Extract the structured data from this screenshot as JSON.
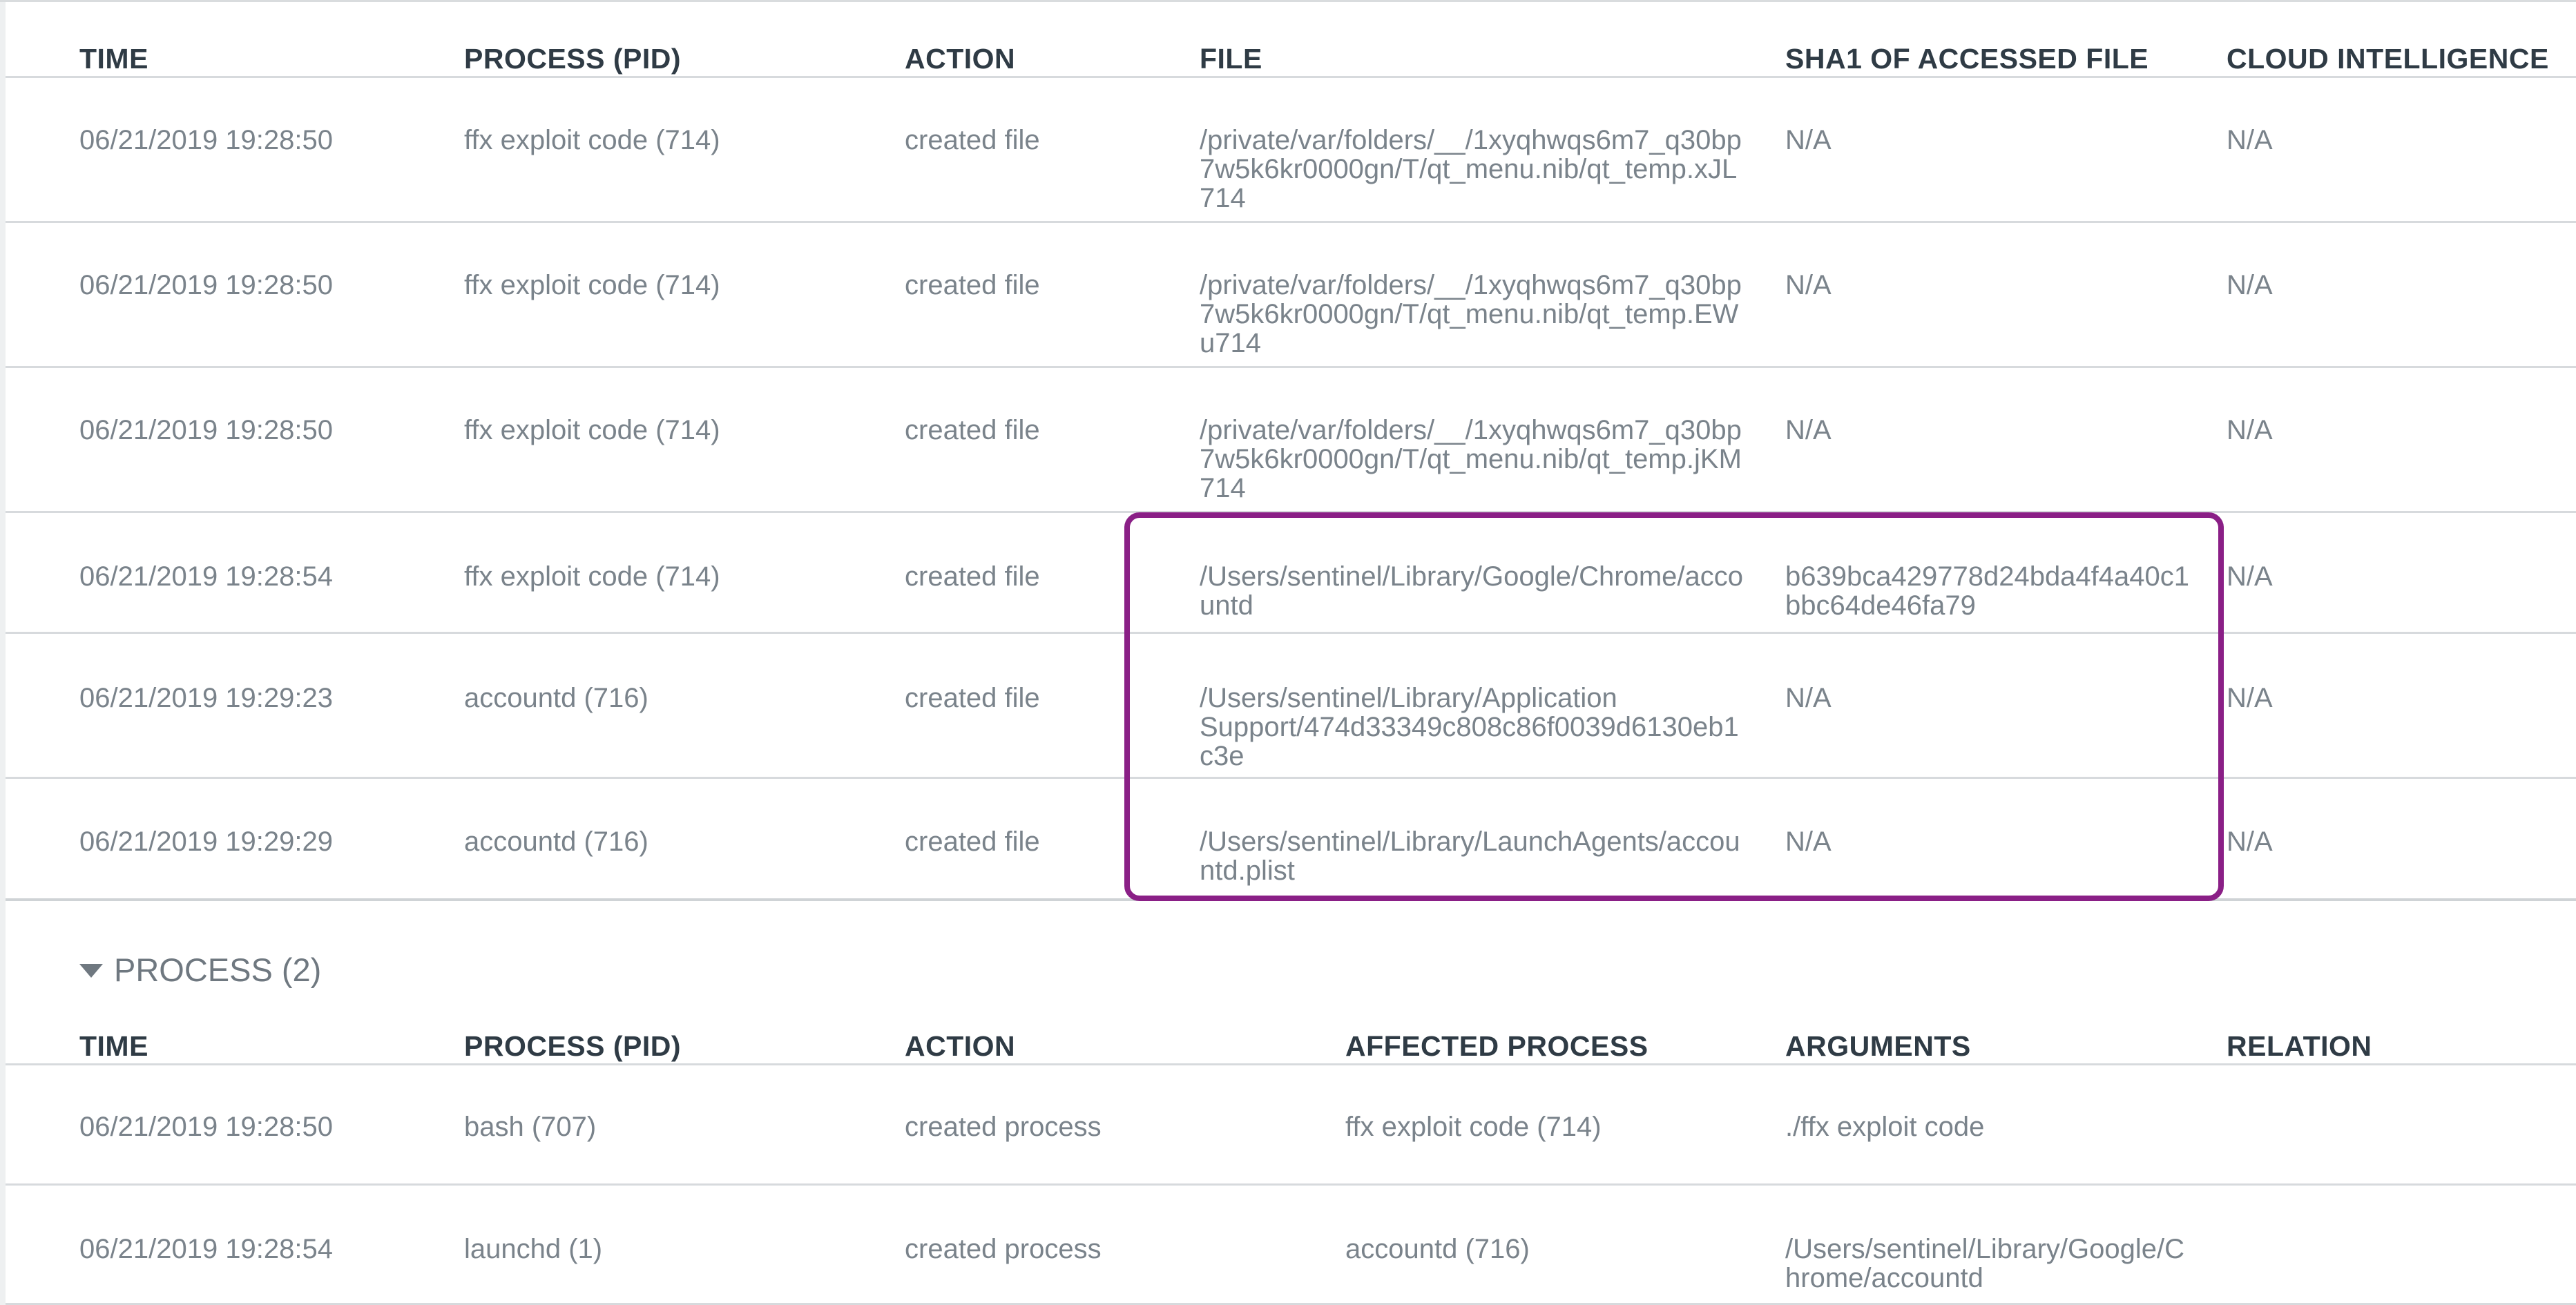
{
  "file_section": {
    "columns": [
      "TIME",
      "PROCESS (PID)",
      "ACTION",
      "FILE",
      "SHA1 OF ACCESSED FILE",
      "CLOUD INTELLIGENCE"
    ],
    "rows": [
      {
        "time": "06/21/2019 19:28:50",
        "process": "ffx exploit code (714)",
        "action": "created file",
        "file": "/private/var/folders/__/1xyqhwqs6m7_q30bp7w5k6kr0000gn/T/qt_menu.nib/qt_temp.xJL714",
        "sha1": "N/A",
        "cloud": "N/A"
      },
      {
        "time": "06/21/2019 19:28:50",
        "process": "ffx exploit code (714)",
        "action": "created file",
        "file": "/private/var/folders/__/1xyqhwqs6m7_q30bp7w5k6kr0000gn/T/qt_menu.nib/qt_temp.EWu714",
        "sha1": "N/A",
        "cloud": "N/A"
      },
      {
        "time": "06/21/2019 19:28:50",
        "process": "ffx exploit code (714)",
        "action": "created file",
        "file": "/private/var/folders/__/1xyqhwqs6m7_q30bp7w5k6kr0000gn/T/qt_menu.nib/qt_temp.jKM714",
        "sha1": "N/A",
        "cloud": "N/A"
      },
      {
        "time": "06/21/2019 19:28:54",
        "process": "ffx exploit code (714)",
        "action": "created file",
        "file": "/Users/sentinel/Library/Google/Chrome/accountd",
        "sha1": "b639bca429778d24bda4f4a40c1bbc64de46fa79",
        "cloud": "N/A"
      },
      {
        "time": "06/21/2019 19:29:23",
        "process": "accountd (716)",
        "action": "created file",
        "file": "/Users/sentinel/Library/Application Support/474d33349c808c86f0039d6130eb1c3e",
        "sha1": "N/A",
        "cloud": "N/A"
      },
      {
        "time": "06/21/2019 19:29:29",
        "process": "accountd (716)",
        "action": "created file",
        "file": "/Users/sentinel/Library/LaunchAgents/accountd.plist",
        "sha1": "N/A",
        "cloud": "N/A"
      }
    ]
  },
  "process_section": {
    "title": "PROCESS (2)",
    "columns": [
      "TIME",
      "PROCESS (PID)",
      "ACTION",
      "AFFECTED PROCESS",
      "ARGUMENTS",
      "RELATION"
    ],
    "rows": [
      {
        "time": "06/21/2019 19:28:50",
        "process": "bash (707)",
        "action": "created process",
        "affected": "ffx exploit code (714)",
        "arguments": "./ffx exploit code",
        "relation": ""
      },
      {
        "time": "06/21/2019 19:28:54",
        "process": "launchd (1)",
        "action": "created process",
        "affected": "accountd (716)",
        "arguments": "/Users/sentinel/Library/Google/Chrome/accountd",
        "relation": ""
      }
    ]
  },
  "colors": {
    "highlight": "#8a1f86",
    "header_text": "#2f3b45",
    "cell_text": "#7a838b"
  },
  "icons": {
    "section_toggle": "caret-down-icon"
  }
}
